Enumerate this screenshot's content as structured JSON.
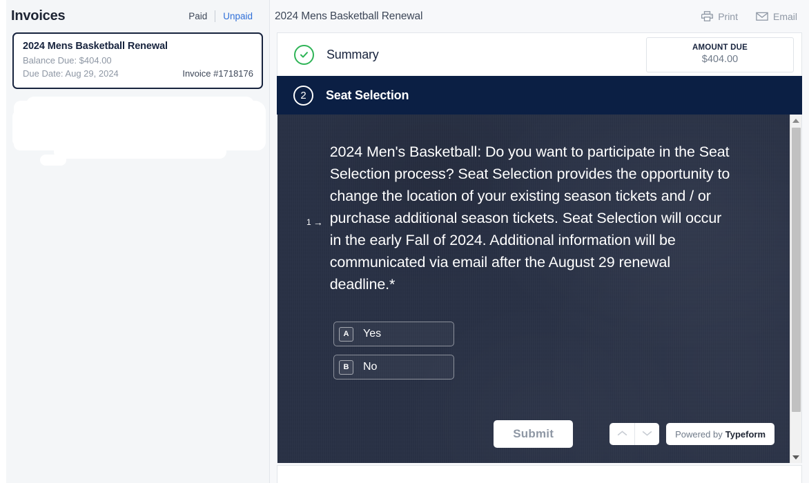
{
  "sidebar": {
    "title": "Invoices",
    "filters": [
      {
        "label": "Paid",
        "active": true
      },
      {
        "label": "Unpaid",
        "active": false
      }
    ],
    "invoices": [
      {
        "title": "2024 Mens Basketball Renewal",
        "balance_due": "Balance Due: $404.00",
        "due_date": "Due Date: Aug 29, 2024",
        "invoice_number": "Invoice #1718176",
        "selected": true
      },
      {
        "redacted": true
      }
    ]
  },
  "content": {
    "title": "2024 Mens Basketball Renewal",
    "actions": [
      {
        "label": "Print",
        "icon": "printer-icon"
      },
      {
        "label": "Email",
        "icon": "envelope-icon"
      }
    ],
    "summary": {
      "label": "Summary",
      "status_icon": "check-circle-icon",
      "amount_due_label": "AMOUNT DUE",
      "amount_due_value": "$404.00"
    },
    "step": {
      "number": "2",
      "label": "Seat Selection"
    },
    "typeform": {
      "question_index": "1",
      "question_arrow": "→",
      "question_text": "2024 Men's Basketball: Do you want to participate in the Seat Selection process? Seat Selection provides the opportunity to change the location of your existing season tickets and / or purchase additional season tickets. Seat Selection will occur in the early Fall of 2024. Additional information will be communicated via email after the August 29 renewal deadline.*",
      "choices": [
        {
          "key": "A",
          "label": "Yes"
        },
        {
          "key": "B",
          "label": "No"
        }
      ],
      "submit_label": "Submit",
      "nav_up_icon": "chevron-up-icon",
      "nav_down_icon": "chevron-down-icon",
      "powered_by_prefix": "Powered by",
      "powered_by_brand": "Typeform"
    }
  },
  "colors": {
    "navy": "#0b1f44",
    "typeform_bg": "#262e42",
    "link_blue": "#2f6fd8",
    "success_green": "#2fb457",
    "page_bg": "#f4f6f8"
  }
}
